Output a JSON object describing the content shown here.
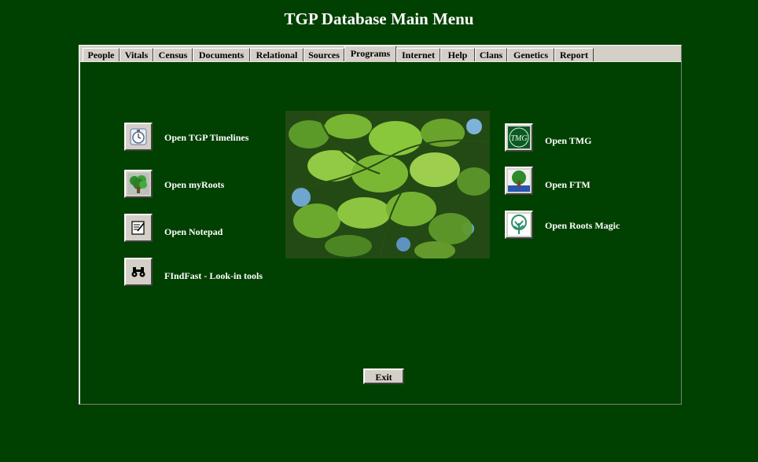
{
  "window": {
    "title": "TGP Database Main Menu"
  },
  "tabs": [
    {
      "label": "People"
    },
    {
      "label": "Vitals"
    },
    {
      "label": "Census"
    },
    {
      "label": "Documents"
    },
    {
      "label": "Relational"
    },
    {
      "label": "Sources"
    },
    {
      "label": "Programs",
      "active": true
    },
    {
      "label": "Internet"
    },
    {
      "label": "Help"
    },
    {
      "label": "Clans"
    },
    {
      "label": "Genetics"
    },
    {
      "label": "Report"
    }
  ],
  "programs_left": [
    {
      "label": "Open TGP Timelines",
      "icon": "stopwatch-icon"
    },
    {
      "label": "Open myRoots",
      "icon": "tree-icon"
    },
    {
      "label": "Open Notepad",
      "icon": "notepad-icon"
    },
    {
      "label": "FIndFast - Look-in tools",
      "icon": "binoculars-icon"
    }
  ],
  "programs_right": [
    {
      "label": "Open TMG",
      "icon": "tmg-logo-icon"
    },
    {
      "label": "Open FTM",
      "icon": "ftm-tree-icon"
    },
    {
      "label": "Open Roots Magic",
      "icon": "roots-magic-tree-icon"
    }
  ],
  "footer": {
    "exit_label": "Exit"
  },
  "colors": {
    "background": "#004000",
    "tab_face": "#d4d0c8",
    "label_text": "#ffffff"
  }
}
